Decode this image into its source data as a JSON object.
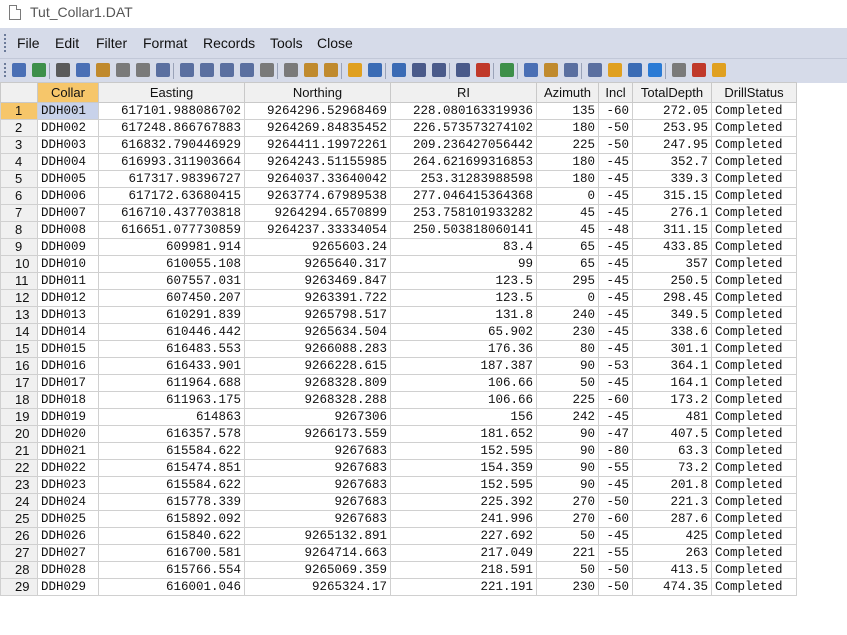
{
  "window": {
    "title": "Tut_Collar1.DAT"
  },
  "menu": [
    "File",
    "Edit",
    "Filter",
    "Format",
    "Records",
    "Tools",
    "Close"
  ],
  "toolbar_colors": [
    "#4a6fb5",
    "#3d8f4a",
    "#5a5a5a",
    "#4a6fb5",
    "#c08a2e",
    "#7a7a7a",
    "#7a7a7a",
    "#5a6fa0",
    "#5a6fa0",
    "#5a6fa0",
    "#5a6fa0",
    "#5a6fa0",
    "#7a7a7a",
    "#7a7a7a",
    "#c08a2e",
    "#c08a2e",
    "#e0a020",
    "#3a6bb5",
    "#3a6bb5",
    "#4a5a8a",
    "#4a5a8a",
    "#4a5a8a",
    "#c0392b",
    "#3d8f4a",
    "#4a6fb5",
    "#c08a2e",
    "#5a6fa0",
    "#5a6fa0",
    "#e0a020",
    "#3a6bb5",
    "#2a7ad5",
    "#7a7a7a",
    "#c0392b",
    "#e0a020"
  ],
  "table": {
    "columns": [
      "Collar",
      "Easting",
      "Northing",
      "RI",
      "Azimuth",
      "Incl",
      "TotalDepth",
      "DrillStatus"
    ],
    "rows": [
      [
        "DDH001",
        "617101.988086702",
        "9264296.52968469",
        "228.080163319936",
        "135",
        "-60",
        "272.05",
        "Completed"
      ],
      [
        "DDH002",
        "617248.866767883",
        "9264269.84835452",
        "226.573573274102",
        "180",
        "-50",
        "253.95",
        "Completed"
      ],
      [
        "DDH003",
        "616832.790446929",
        "9264411.19972261",
        "209.236427056442",
        "225",
        "-50",
        "247.95",
        "Completed"
      ],
      [
        "DDH004",
        "616993.311903664",
        "9264243.51155985",
        "264.621699316853",
        "180",
        "-45",
        "352.7",
        "Completed"
      ],
      [
        "DDH005",
        "617317.98396727",
        "9264037.33640042",
        "253.31283988598",
        "180",
        "-45",
        "339.3",
        "Completed"
      ],
      [
        "DDH006",
        "617172.63680415",
        "9263774.67989538",
        "277.046415364368",
        "0",
        "-45",
        "315.15",
        "Completed"
      ],
      [
        "DDH007",
        "616710.437703818",
        "9264294.6570899",
        "253.758101933282",
        "45",
        "-45",
        "276.1",
        "Completed"
      ],
      [
        "DDH008",
        "616651.077730859",
        "9264237.33334054",
        "250.503818060141",
        "45",
        "-48",
        "311.15",
        "Completed"
      ],
      [
        "DDH009",
        "609981.914",
        "9265603.24",
        "83.4",
        "65",
        "-45",
        "433.85",
        "Completed"
      ],
      [
        "DDH010",
        "610055.108",
        "9265640.317",
        "99",
        "65",
        "-45",
        "357",
        "Completed"
      ],
      [
        "DDH011",
        "607557.031",
        "9263469.847",
        "123.5",
        "295",
        "-45",
        "250.5",
        "Completed"
      ],
      [
        "DDH012",
        "607450.207",
        "9263391.722",
        "123.5",
        "0",
        "-45",
        "298.45",
        "Completed"
      ],
      [
        "DDH013",
        "610291.839",
        "9265798.517",
        "131.8",
        "240",
        "-45",
        "349.5",
        "Completed"
      ],
      [
        "DDH014",
        "610446.442",
        "9265634.504",
        "65.902",
        "230",
        "-45",
        "338.6",
        "Completed"
      ],
      [
        "DDH015",
        "616483.553",
        "9266088.283",
        "176.36",
        "80",
        "-45",
        "301.1",
        "Completed"
      ],
      [
        "DDH016",
        "616433.901",
        "9266228.615",
        "187.387",
        "90",
        "-53",
        "364.1",
        "Completed"
      ],
      [
        "DDH017",
        "611964.688",
        "9268328.809",
        "106.66",
        "50",
        "-45",
        "164.1",
        "Completed"
      ],
      [
        "DDH018",
        "611963.175",
        "9268328.288",
        "106.66",
        "225",
        "-60",
        "173.2",
        "Completed"
      ],
      [
        "DDH019",
        "614863",
        "9267306",
        "156",
        "242",
        "-45",
        "481",
        "Completed"
      ],
      [
        "DDH020",
        "616357.578",
        "9266173.559",
        "181.652",
        "90",
        "-47",
        "407.5",
        "Completed"
      ],
      [
        "DDH021",
        "615584.622",
        "9267683",
        "152.595",
        "90",
        "-80",
        "63.3",
        "Completed"
      ],
      [
        "DDH022",
        "615474.851",
        "9267683",
        "154.359",
        "90",
        "-55",
        "73.2",
        "Completed"
      ],
      [
        "DDH023",
        "615584.622",
        "9267683",
        "152.595",
        "90",
        "-45",
        "201.8",
        "Completed"
      ],
      [
        "DDH024",
        "615778.339",
        "9267683",
        "225.392",
        "270",
        "-50",
        "221.3",
        "Completed"
      ],
      [
        "DDH025",
        "615892.092",
        "9267683",
        "241.996",
        "270",
        "-60",
        "287.6",
        "Completed"
      ],
      [
        "DDH026",
        "615840.622",
        "9265132.891",
        "227.692",
        "50",
        "-45",
        "425",
        "Completed"
      ],
      [
        "DDH027",
        "616700.581",
        "9264714.663",
        "217.049",
        "221",
        "-55",
        "263",
        "Completed"
      ],
      [
        "DDH028",
        "615766.554",
        "9265069.359",
        "218.591",
        "50",
        "-50",
        "413.5",
        "Completed"
      ],
      [
        "DDH029",
        "616001.046",
        "9265324.17",
        "221.191",
        "230",
        "-50",
        "474.35",
        "Completed"
      ]
    ]
  }
}
